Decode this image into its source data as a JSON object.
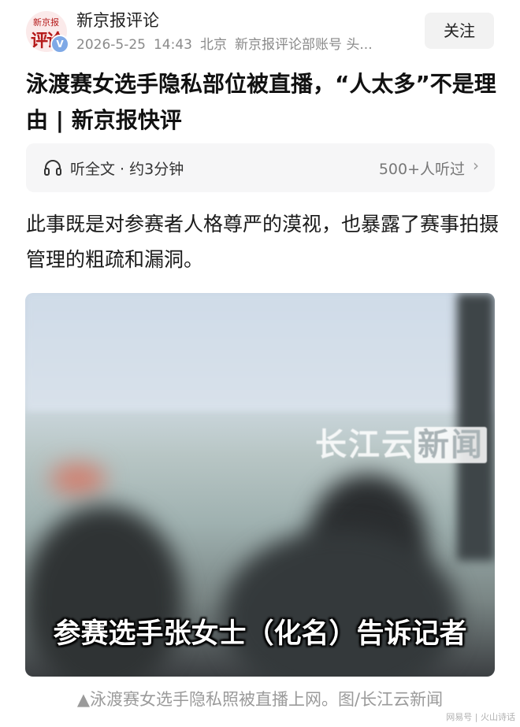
{
  "header": {
    "account_name": "新京报评论",
    "avatar_logo_top": "新京报",
    "avatar_logo_bottom": "评论",
    "verified_mark": "V",
    "date": "2026-5-25",
    "time": "14:43",
    "location": "北京",
    "account_type": "新京报评论部账号 头...",
    "follow_label": "关注"
  },
  "article": {
    "title": "泳渡赛女选手隐私部位被直播，“人太多”不是理由 | 新京报快评",
    "audio": {
      "listen_label": "听全文 · 约3分钟",
      "listener_count": "500+人听过",
      "chevron": "›"
    },
    "lead": "此事既是对参赛者人格尊严的漠视，也暴露了赛事拍摄管理的粗疏和漏洞。",
    "image": {
      "watermark_prefix": "长江云",
      "watermark_boxed": "新闻",
      "subtitle": "参赛选手张女士（化名）告诉记者"
    },
    "caption": "▲泳渡赛女选手隐私照被直播上网。图/长江云新闻"
  },
  "footer": {
    "source_mark": "网易号 | 火山诗话"
  },
  "icons": {
    "headphone": "headphone-icon",
    "verified": "verified-badge-icon",
    "chevron": "chevron-right-icon"
  }
}
